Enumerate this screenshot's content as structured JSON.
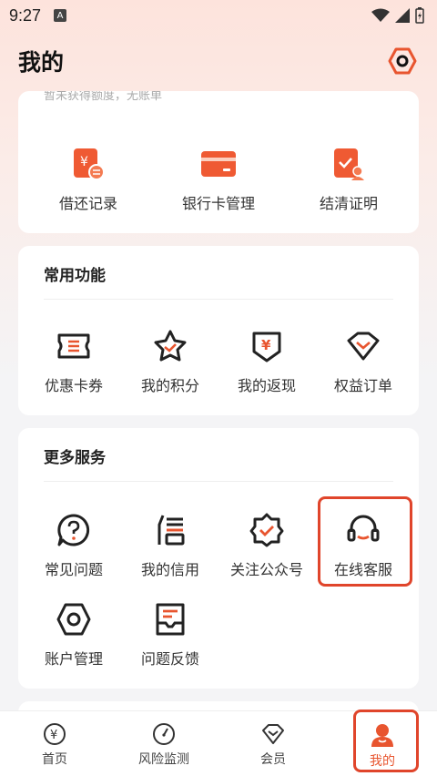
{
  "status": {
    "time": "9:27",
    "notify": "A"
  },
  "header": {
    "title": "我的",
    "settings_icon": "gear-hex-icon"
  },
  "loan_card": {
    "top_text": "暂未获得额度，无账单",
    "items": [
      {
        "label": "借还记录",
        "icon": "loan-record-icon"
      },
      {
        "label": "银行卡管理",
        "icon": "bank-card-icon"
      },
      {
        "label": "结清证明",
        "icon": "settlement-proof-icon"
      }
    ]
  },
  "common": {
    "title": "常用功能",
    "items": [
      {
        "label": "优惠卡券",
        "icon": "coupon-icon"
      },
      {
        "label": "我的积分",
        "icon": "points-star-icon"
      },
      {
        "label": "我的返现",
        "icon": "cashback-icon"
      },
      {
        "label": "权益订单",
        "icon": "benefit-order-icon"
      }
    ]
  },
  "more": {
    "title": "更多服务",
    "items": [
      {
        "label": "常见问题",
        "icon": "faq-icon"
      },
      {
        "label": "我的信用",
        "icon": "credit-icon"
      },
      {
        "label": "关注公众号",
        "icon": "follow-account-icon"
      },
      {
        "label": "在线客服",
        "icon": "headset-icon"
      },
      {
        "label": "账户管理",
        "icon": "account-manage-icon"
      },
      {
        "label": "问题反馈",
        "icon": "feedback-icon"
      }
    ]
  },
  "tabbar": {
    "items": [
      {
        "label": "首页",
        "icon": "home-yuan-icon"
      },
      {
        "label": "风险监测",
        "icon": "risk-gauge-icon"
      },
      {
        "label": "会员",
        "icon": "member-icon"
      },
      {
        "label": "我的",
        "icon": "profile-icon"
      }
    ],
    "active_index": 3
  },
  "colors": {
    "accent": "#e8552f",
    "highlight": "#e0452b",
    "icon_dark": "#222222"
  }
}
